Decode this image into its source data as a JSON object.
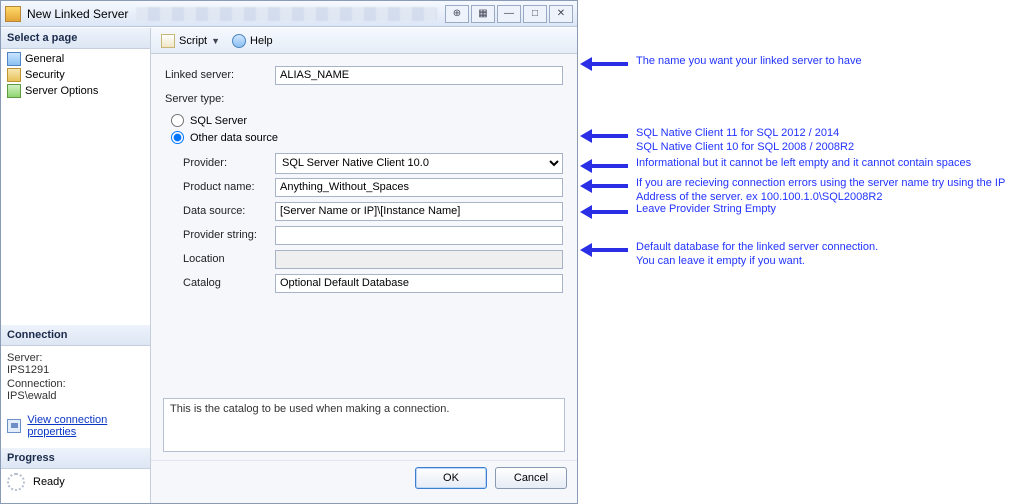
{
  "window": {
    "title": "New Linked Server",
    "btn_alt1": "⊕",
    "btn_alt2": "▦",
    "btn_min": "—",
    "btn_max": "□",
    "btn_close": "✕"
  },
  "leftpanel": {
    "select_page": "Select a page",
    "pages": [
      {
        "label": "General"
      },
      {
        "label": "Security"
      },
      {
        "label": "Server Options"
      }
    ],
    "connection_hdr": "Connection",
    "server_lbl": "Server:",
    "server_val": "IPS1291",
    "connection_lbl": "Connection:",
    "connection_val": "IPS\\ewald",
    "view_link": "View connection properties",
    "progress_hdr": "Progress",
    "progress_state": "Ready"
  },
  "toolbar": {
    "script": "Script",
    "help": "Help"
  },
  "form": {
    "linked_server_lbl": "Linked server:",
    "linked_server_val": "ALIAS_NAME",
    "server_type_lbl": "Server type:",
    "radio_sql": "SQL Server",
    "radio_other": "Other data source",
    "provider_lbl": "Provider:",
    "provider_val": "SQL Server Native Client 10.0",
    "product_lbl": "Product name:",
    "product_val": "Anything_Without_Spaces",
    "datasource_lbl": "Data source:",
    "datasource_val": "[Server Name or IP]\\[Instance Name]",
    "provider_string_lbl": "Provider string:",
    "provider_string_val": "",
    "location_lbl": "Location",
    "location_val": "",
    "catalog_lbl": "Catalog",
    "catalog_val": "Optional Default Database",
    "helptext": "This is the catalog to be used when making a connection."
  },
  "buttons": {
    "ok": "OK",
    "cancel": "Cancel"
  },
  "annotations": {
    "a1": "The name you want your linked server to have",
    "a2": "SQL Native Client 11 for SQL 2012 / 2014\nSQL Native Client 10 for SQL 2008 / 2008R2",
    "a3": "Informational but it cannot be left empty and it cannot contain spaces",
    "a4": "If you are recieving connection errors using the server name try using the IP Address of the server. ex 100.100.1.0\\SQL2008R2",
    "a5": "Leave Provider String Empty",
    "a6": "Default database for the linked server connection.\nYou can leave it empty if you want."
  }
}
